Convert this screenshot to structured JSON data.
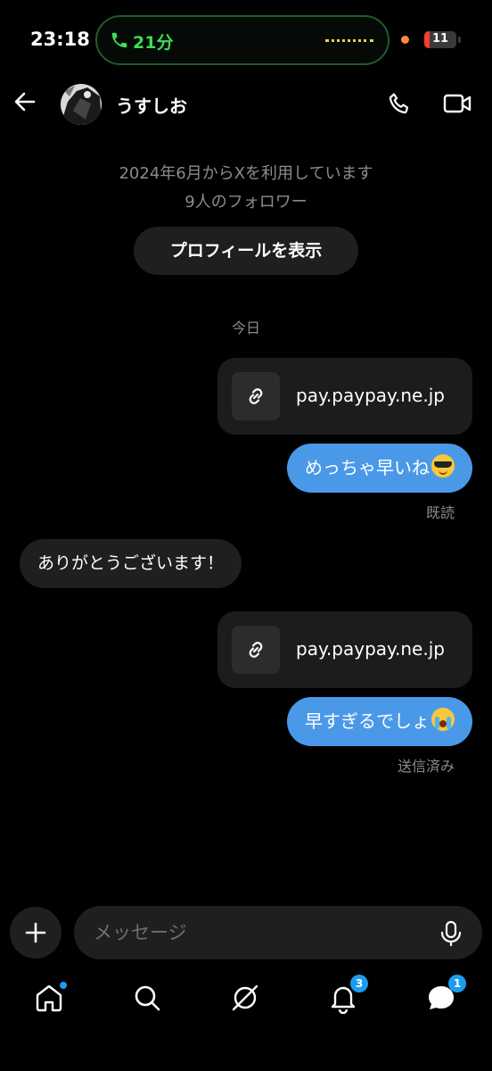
{
  "status_bar": {
    "time": "23:18",
    "call_duration": "21分",
    "battery_level": "11",
    "accent_green": "#3ddc5a"
  },
  "header": {
    "contact_name": "うすしお",
    "icons": [
      "back-arrow-icon",
      "phone-icon",
      "video-icon"
    ]
  },
  "profile": {
    "since": "2024年6月からXを利用しています",
    "followers": "9人のフォロワー",
    "view_profile_label": "プロフィールを表示"
  },
  "conversation": {
    "day_label": "今日",
    "messages": [
      {
        "type": "link",
        "direction": "out",
        "url": "pay.paypay.ne.jp"
      },
      {
        "type": "text",
        "direction": "out",
        "text": "めっちゃ早いね",
        "emoji": "smiling-face-with-sunglasses"
      },
      {
        "type": "receipt",
        "text": "既読"
      },
      {
        "type": "text",
        "direction": "in",
        "text": "ありがとうございます！"
      },
      {
        "type": "link",
        "direction": "out",
        "url": "pay.paypay.ne.jp"
      },
      {
        "type": "text",
        "direction": "out",
        "text": "早すぎるでしょ",
        "emoji": "loudly-crying-face"
      },
      {
        "type": "receipt",
        "text": "送信済み"
      }
    ],
    "bubble_color": "#4a99e9"
  },
  "composer": {
    "placeholder": "メッセージ"
  },
  "bottom_nav": {
    "items": [
      {
        "name": "home",
        "icon": "home-icon",
        "badge": ""
      },
      {
        "name": "search",
        "icon": "search-icon",
        "badge": ""
      },
      {
        "name": "grok",
        "icon": "grok-icon",
        "badge": ""
      },
      {
        "name": "notifications",
        "icon": "bell-icon",
        "badge": "3"
      },
      {
        "name": "messages",
        "icon": "messages-icon",
        "badge": "1"
      }
    ],
    "badge_color": "#1d9bf0"
  }
}
